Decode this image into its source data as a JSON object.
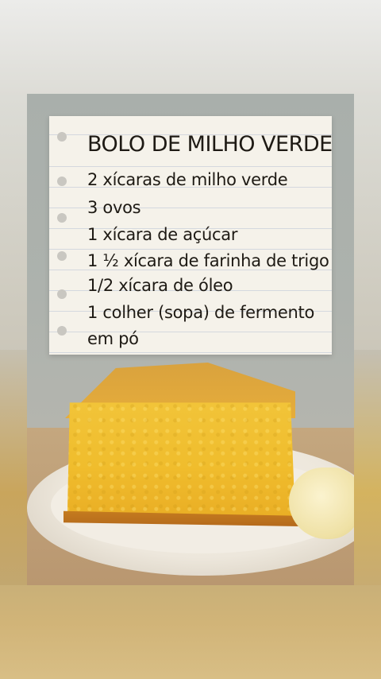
{
  "recipe": {
    "title": "BOLO DE MILHO VERDE",
    "ingredients": [
      "2 xícaras de milho verde",
      "3 ovos",
      "1 xícara de açúcar",
      "1 ½ xícara de farinha de trigo",
      "1/2 xícara de óleo",
      "1 colher (sopa) de fermento",
      "em pó"
    ]
  },
  "colors": {
    "paper": "#f5f2ea",
    "cake": "#f0bd2d",
    "background": "#aab0ab"
  }
}
